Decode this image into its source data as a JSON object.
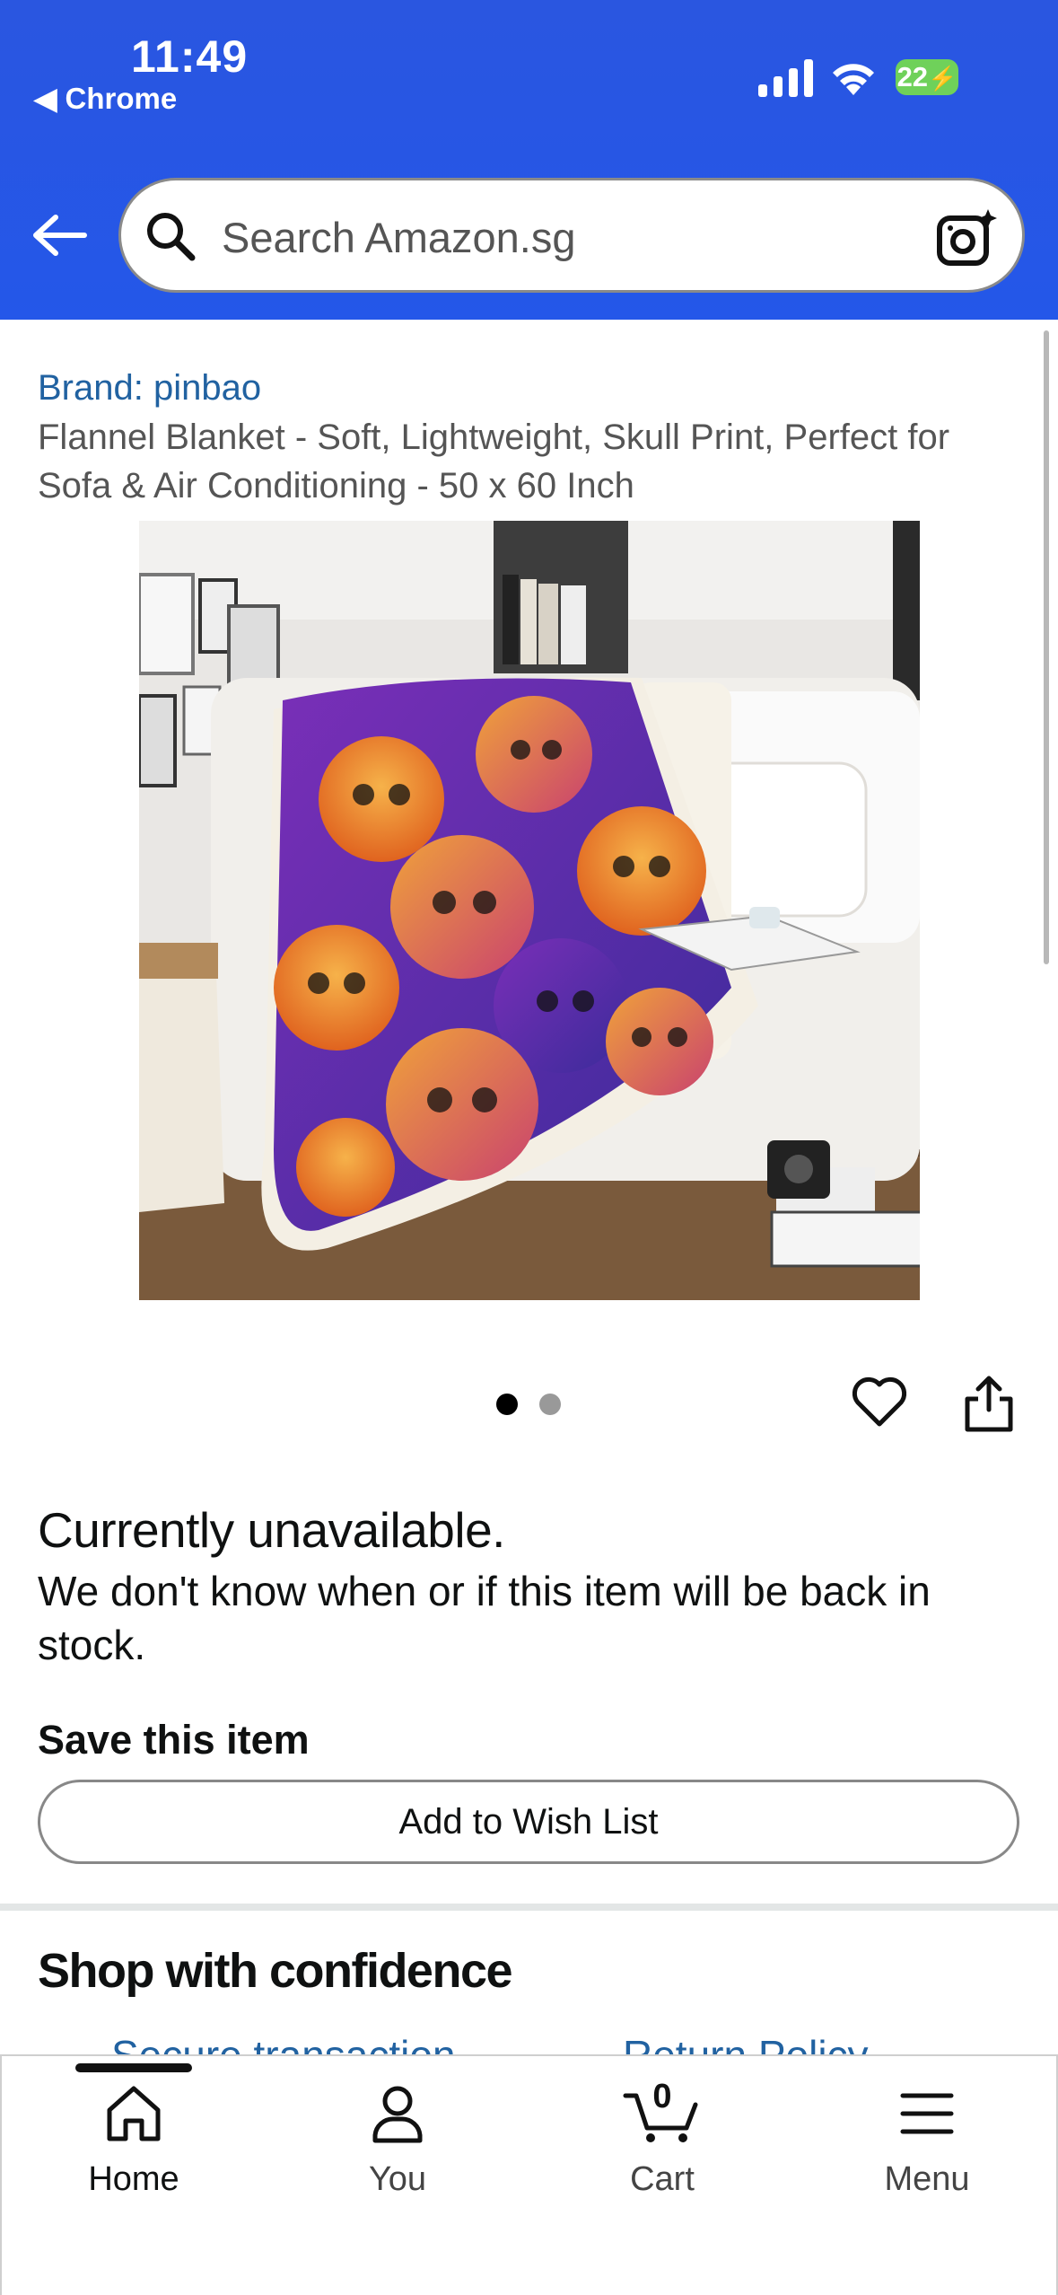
{
  "status_bar": {
    "time": "11:49",
    "back_app": "◀ Chrome",
    "battery": "22"
  },
  "search": {
    "placeholder": "Search Amazon.sg"
  },
  "product": {
    "brand": "Brand: pinbao",
    "title": "Flannel Blanket - Soft, Lightweight, Skull Print, Perfect for Sofa & Air Conditioning - 50 x 60 Inch",
    "image_count": 2,
    "image_index": 1
  },
  "availability": {
    "heading": "Currently unavailable.",
    "message": "We don't know when or if this item will be back in stock."
  },
  "save": {
    "label": "Save this item",
    "wishlist_button": "Add to Wish List"
  },
  "confidence": {
    "heading": "Shop with confidence",
    "items": [
      "Secure transaction",
      "Return Policy"
    ]
  },
  "bottom_nav": {
    "home": "Home",
    "you": "You",
    "cart": "Cart",
    "cart_count": "0",
    "menu": "Menu"
  },
  "colors": {
    "header": "#2457e9",
    "link": "#2162a1",
    "battery": "#6fd15a"
  }
}
